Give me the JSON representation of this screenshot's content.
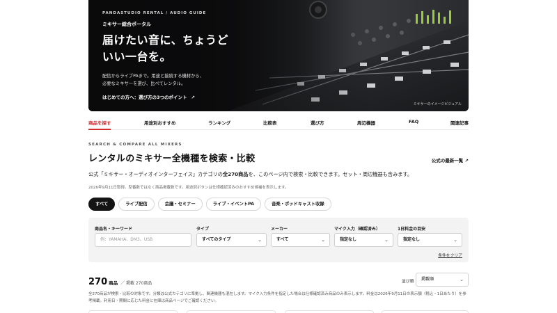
{
  "hero": {
    "kicker": "PANDASTUDIO RENTAL / AUDIO GUIDE",
    "portal": "ミキサー総合ポータル",
    "headline": "届けたい音に、ちょうどいい一台を。",
    "desc_line1": "配信からライブPAまで。用途と接続する機材から、",
    "desc_line2": "必要なミキサーを選び、比べてレンタル。",
    "link_label": "はじめての方へ：選び方の3つのポイント",
    "link_arrow": "↗",
    "caption": "ミキサーのイメージビジュアル"
  },
  "nav": {
    "items": [
      {
        "label": "商品を探す",
        "active": true
      },
      {
        "label": "用途別おすすめ"
      },
      {
        "label": "ランキング"
      },
      {
        "label": "比較表"
      },
      {
        "label": "選び方"
      },
      {
        "label": "周辺機器"
      },
      {
        "label": "FAQ"
      },
      {
        "label": "関連記事"
      }
    ]
  },
  "section": {
    "eyebrow": "SEARCH & COMPARE ALL MIXERS",
    "title": "レンタルのミキサー全機種を検索・比較",
    "news_link": "公式の最新一覧 ↗",
    "intro_pre": "公式「ミキサー・オーディオインターフェイス」カテゴリの",
    "intro_bold": "全270商品",
    "intro_post": "を、このページ内で検索・比較できます。セット・周辺機器も含みます。",
    "note": "2026年9月11日取得。型番数ではなく商品掲載数です。用途別ボタンは仕様確認済みのおすすめ候補を表示します。"
  },
  "chips": [
    "すべて",
    "ライブ配信",
    "会議・セミナー",
    "ライブ・イベントPA",
    "音楽・ポッドキャスト収録"
  ],
  "filters": {
    "keyword_label": "商品名・キーワード",
    "keyword_placeholder": "例：YAMAHA、DM3、USB",
    "type_label": "タイプ",
    "type_value": "すべてのタイプ",
    "maker_label": "メーカー",
    "maker_value": "すべて",
    "mic_label": "マイク入力（確認済み）",
    "mic_value": "指定なし",
    "price_label": "1日料金の目安",
    "price_value": "指定なし",
    "clear_label": "条件をクリア"
  },
  "results": {
    "count": "270",
    "unit": "商品",
    "sub": "／ 掲載 270商品",
    "sort_label": "並び順",
    "sort_value": "掲載順",
    "disclaimer": "全270商品が検索・比較の対象です。分類は公式カテゴリに準拠し、関連機器も混在します。マイク入力条件を指定した場合は仕様確認済み商品のみ表示します。料金は2026年9月11日の表示額（税込・1日あたり）を参考掲載。利用日・期間に応じた料金と在庫は商品ページでご確認ください。"
  },
  "icons": {
    "chevron": "⌄"
  },
  "colors": {
    "accent": "#d12d2d",
    "chip_active": "#141414",
    "panel": "#f3f3f3"
  }
}
